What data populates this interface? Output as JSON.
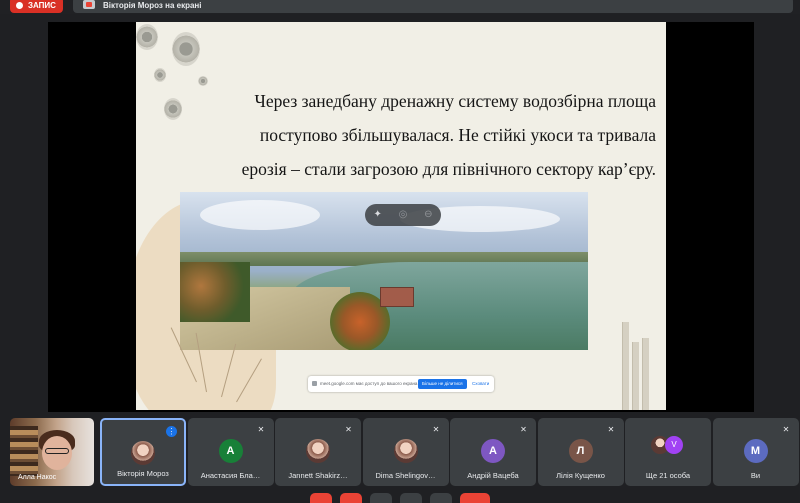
{
  "top_bar": {
    "record_label": "ЗАПИС",
    "presenting_text": "Вікторія Мороз на екрані"
  },
  "slide": {
    "lines": [
      "Через занедбану дренажну систему водозбірна площа",
      "поступово збільшувалася. Не стійкі укоси та тривала",
      "ерозія – стали загрозою для північного сектору кар’єру."
    ],
    "share_bar": {
      "message": "meet.google.com має доступ до вашого екрана",
      "stop_label": "Більше не ділитися",
      "hide_label": "Сховати"
    }
  },
  "participants": {
    "self": {
      "name": "Алла Накос"
    },
    "tiles": [
      {
        "name": "Вікторія Мороз",
        "avatar": "",
        "avatar_color": "#c0392b",
        "photo": true,
        "active": true,
        "mic": "more-icon"
      },
      {
        "name": "Анастасия Бла…",
        "avatar": "A",
        "avatar_color": "#188038",
        "mic": "mic-off-icon"
      },
      {
        "name": "Jannett Shakirz…",
        "avatar": "",
        "photo": true,
        "mic": "mic-off-icon"
      },
      {
        "name": "Dima Shelingov…",
        "avatar": "",
        "photo": true,
        "mic": "mic-off-icon"
      },
      {
        "name": "Андрій Вацеба",
        "avatar": "A",
        "avatar_color": "#7e57c2",
        "mic": "mic-off-icon"
      },
      {
        "name": "Лілія Кущенко",
        "avatar": "Л",
        "avatar_color": "#795548",
        "mic": "mic-off-icon"
      },
      {
        "name": "Ще 21 особа",
        "avatar": "",
        "mic": ""
      },
      {
        "name": "Ви",
        "avatar": "M",
        "avatar_color": "#5c6bc0",
        "mic": "mic-off-icon"
      }
    ],
    "more_avatars": [
      "V"
    ]
  }
}
